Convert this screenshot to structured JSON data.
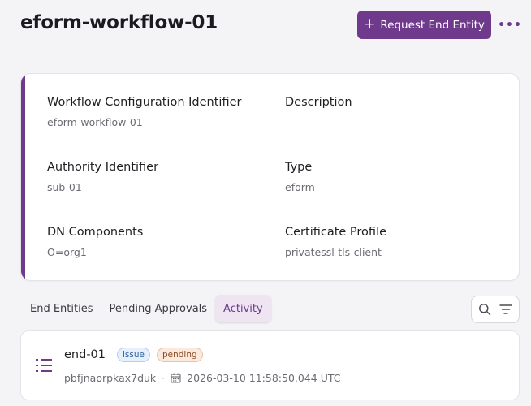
{
  "header": {
    "title": "eform-workflow-01",
    "primary_action": "Request End Entity",
    "more_label": "•••"
  },
  "details": {
    "fields": [
      {
        "label": "Workflow Configuration Identifier",
        "value": "eform-workflow-01"
      },
      {
        "label": "Description",
        "value": ""
      },
      {
        "label": "Authority Identifier",
        "value": "sub-01"
      },
      {
        "label": "Type",
        "value": "eform"
      },
      {
        "label": "DN Components",
        "value": "O=org1"
      },
      {
        "label": "Certificate Profile",
        "value": "privatessl-tls-client"
      }
    ]
  },
  "tabs": [
    {
      "label": "End Entities",
      "active": false
    },
    {
      "label": "Pending Approvals",
      "active": false
    },
    {
      "label": "Activity",
      "active": true
    }
  ],
  "activity": {
    "items": [
      {
        "name": "end-01",
        "badges": [
          "issue",
          "pending"
        ],
        "id": "pbfjnaorpkax7duk",
        "separator": "·",
        "timestamp": "2026-03-10 11:58:50.044 UTC"
      }
    ]
  },
  "colors": {
    "accent": "#6f3a8c",
    "issue_badge": "#e6f0fb",
    "pending_badge": "#fbe9dc"
  },
  "icons": [
    "plus-icon",
    "more-icon",
    "search-icon",
    "filter-icon",
    "list-icon",
    "calendar-icon"
  ]
}
